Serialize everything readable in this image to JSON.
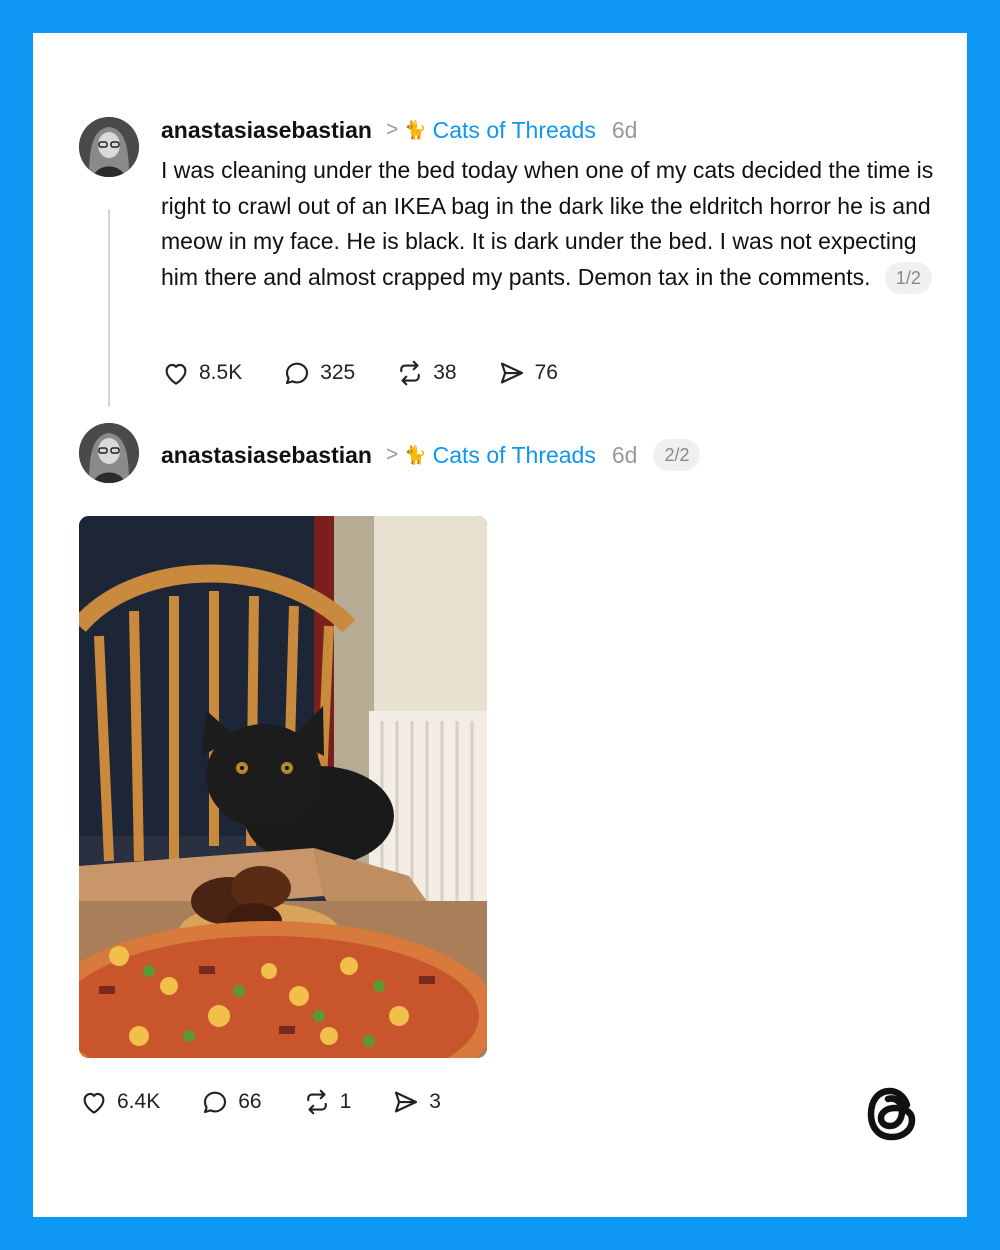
{
  "post1": {
    "username": "anastasiasebastian",
    "separator": ">",
    "community_icon": "cat-icon",
    "community": "Cats of Threads",
    "time": "6d",
    "text": "I was cleaning under the bed today when one of my cats decided the time is right to crawl out of an IKEA bag in the dark like the eldritch horror he is and meow in my face. He is black. It is dark under the bed. I was not expecting him there and almost crapped my pants. Demon tax in the comments.",
    "page": "1/2",
    "likes": "8.5K",
    "replies": "325",
    "reposts": "38",
    "shares": "76"
  },
  "post2": {
    "username": "anastasiasebastian",
    "separator": ">",
    "community_icon": "cat-icon",
    "community": "Cats of Threads",
    "time": "6d",
    "page": "2/2",
    "image": "black cat sitting on a wooden chair behind an open pizza box",
    "likes": "6.4K",
    "replies": "66",
    "reposts": "1",
    "shares": "3"
  },
  "brand": {
    "logo": "threads-logo-icon",
    "border_color": "#0d96f2",
    "accent_color": "#0d96f2"
  }
}
